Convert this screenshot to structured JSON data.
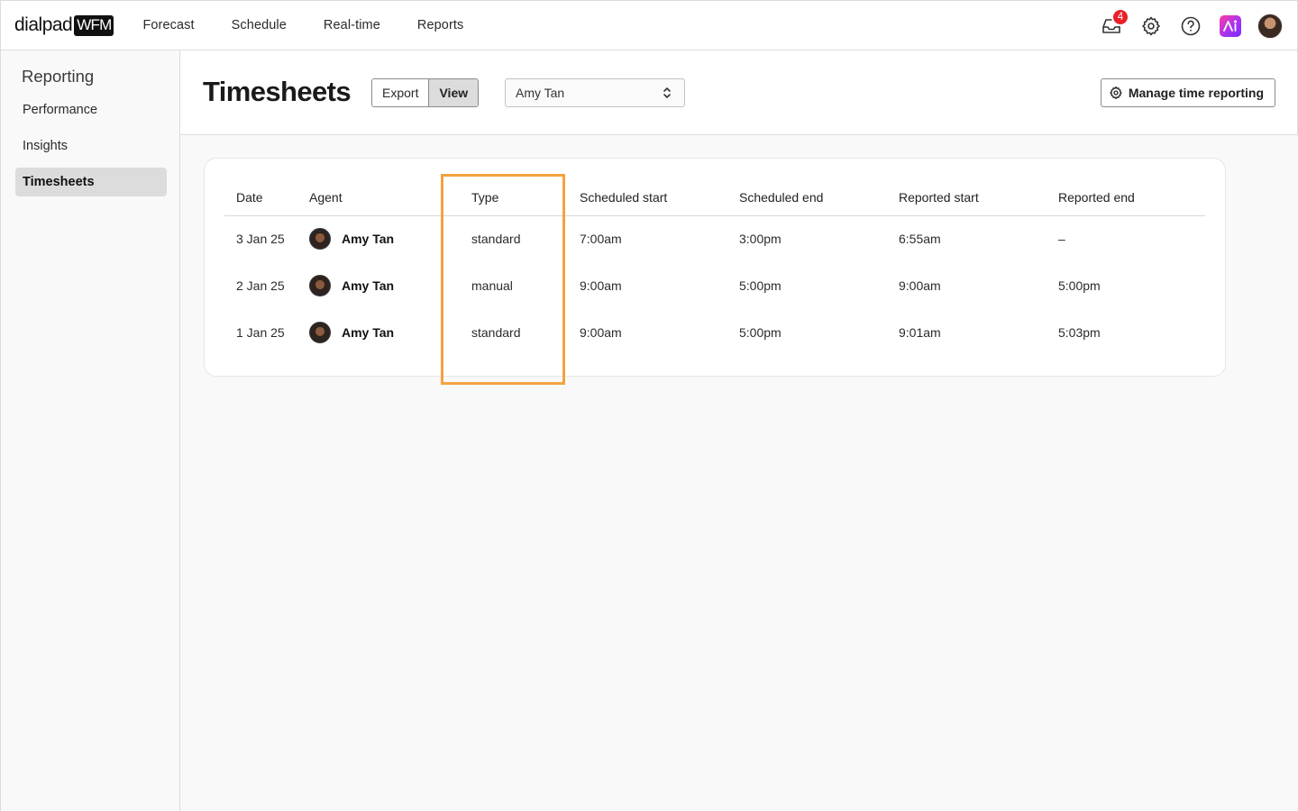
{
  "brand": {
    "word": "dialpad",
    "badge": "WFM"
  },
  "topnav": [
    {
      "label": "Forecast"
    },
    {
      "label": "Schedule"
    },
    {
      "label": "Real-time"
    },
    {
      "label": "Reports"
    }
  ],
  "top_actions": {
    "inbox_count": "4"
  },
  "sidebar": {
    "title": "Reporting",
    "items": [
      {
        "label": "Performance"
      },
      {
        "label": "Insights"
      },
      {
        "label": "Timesheets",
        "active": true
      }
    ]
  },
  "header": {
    "title": "Timesheets",
    "toggle": {
      "export_label": "Export",
      "view_label": "View",
      "selected": "View"
    },
    "agent_select": {
      "value": "Amy Tan"
    },
    "manage_label": "Manage time reporting"
  },
  "table": {
    "columns": [
      "Date",
      "Agent",
      "Type",
      "Scheduled start",
      "Scheduled end",
      "Reported start",
      "Reported end"
    ],
    "rows": [
      {
        "date": "3 Jan 25",
        "agent": "Amy Tan",
        "type": "standard",
        "scheduled_start": "7:00am",
        "scheduled_end": "3:00pm",
        "reported_start": "6:55am",
        "reported_end": "–"
      },
      {
        "date": "2 Jan 25",
        "agent": "Amy Tan",
        "type": "manual",
        "scheduled_start": "9:00am",
        "scheduled_end": "5:00pm",
        "reported_start": "9:00am",
        "reported_end": "5:00pm"
      },
      {
        "date": "1 Jan 25",
        "agent": "Amy Tan",
        "type": "standard",
        "scheduled_start": "9:00am",
        "scheduled_end": "5:00pm",
        "reported_start": "9:01am",
        "reported_end": "5:03pm"
      }
    ]
  },
  "colors": {
    "highlight": "#f4a240",
    "badge": "#e8202a",
    "selected_bg": "#dcdcdc"
  }
}
